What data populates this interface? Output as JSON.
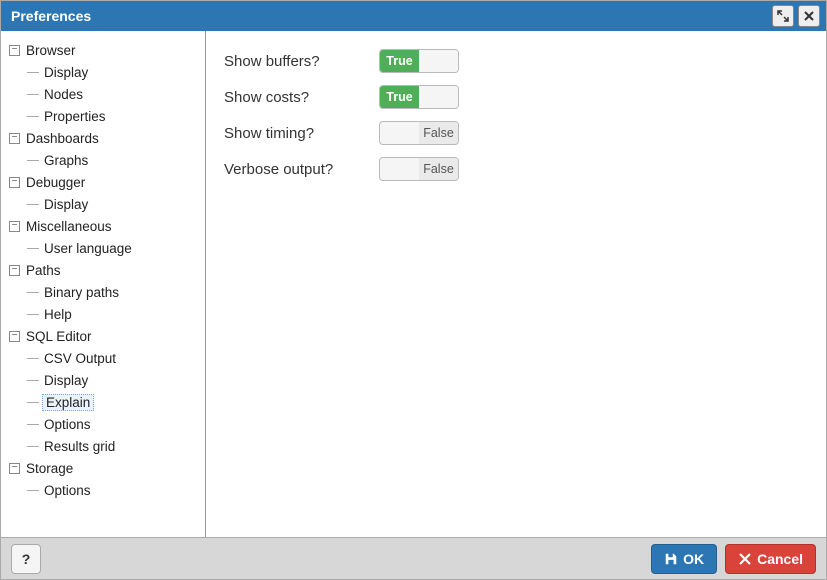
{
  "window": {
    "title": "Preferences"
  },
  "tree": {
    "browser": {
      "label": "Browser",
      "display": "Display",
      "nodes": "Nodes",
      "properties": "Properties"
    },
    "dashboards": {
      "label": "Dashboards",
      "graphs": "Graphs"
    },
    "debugger": {
      "label": "Debugger",
      "display": "Display"
    },
    "miscellaneous": {
      "label": "Miscellaneous",
      "user_language": "User language"
    },
    "paths": {
      "label": "Paths",
      "binary_paths": "Binary paths",
      "help": "Help"
    },
    "sql_editor": {
      "label": "SQL Editor",
      "csv_output": "CSV Output",
      "display": "Display",
      "explain": "Explain",
      "options": "Options",
      "results_grid": "Results grid"
    },
    "storage": {
      "label": "Storage",
      "options": "Options"
    }
  },
  "settings": {
    "show_buffers": {
      "label": "Show buffers?",
      "value": true
    },
    "show_costs": {
      "label": "Show costs?",
      "value": true
    },
    "show_timing": {
      "label": "Show timing?",
      "value": false
    },
    "verbose_output": {
      "label": "Verbose output?",
      "value": false
    }
  },
  "toggle_text": {
    "true": "True",
    "false": "False"
  },
  "footer": {
    "help": "?",
    "ok": "OK",
    "cancel": "Cancel"
  }
}
